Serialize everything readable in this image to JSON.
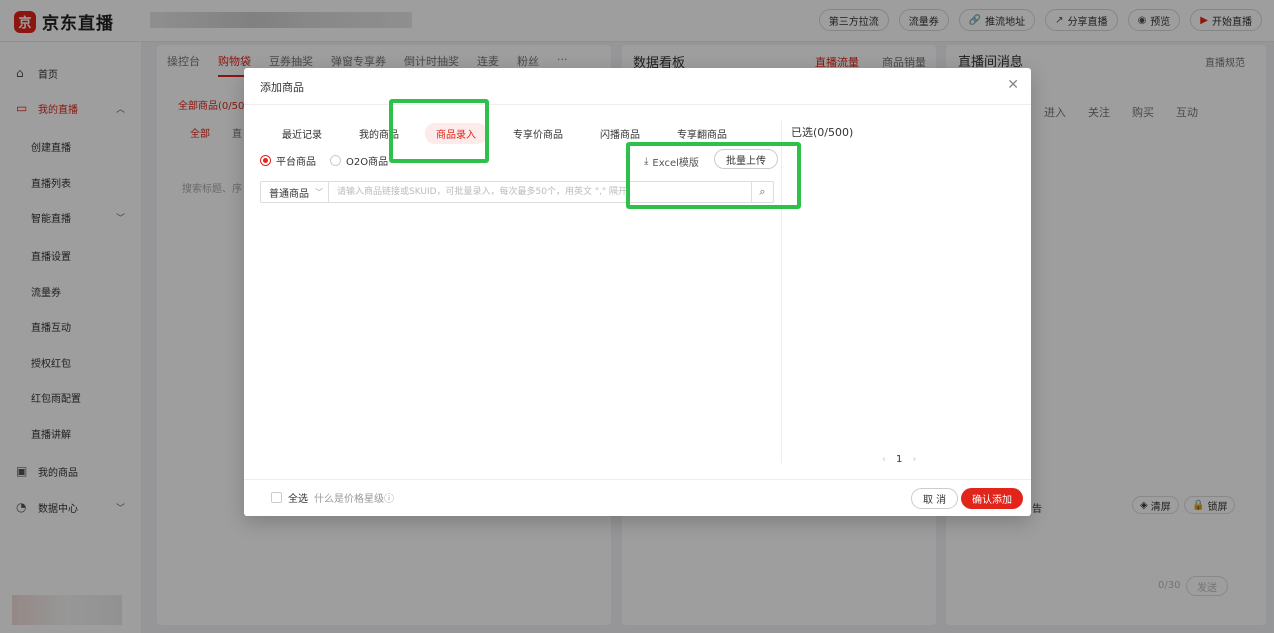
{
  "app": {
    "logo_mark": "京",
    "logo_text": "京东直播"
  },
  "top_actions": [
    {
      "label": "第三方拉流",
      "icon": ""
    },
    {
      "label": "流量券",
      "icon": ""
    },
    {
      "label": "推流地址",
      "icon": "🔗"
    },
    {
      "label": "分享直播",
      "icon": "↗"
    },
    {
      "label": "预览",
      "icon": "◉"
    },
    {
      "label": "开始直播",
      "icon": "▶"
    }
  ],
  "sidebar": {
    "home": "首页",
    "my_live": "我的直播",
    "sub_items": [
      "创建直播",
      "直播列表",
      "智能直播",
      "直播设置",
      "流量券",
      "直播互动",
      "授权红包",
      "红包雨配置",
      "直播讲解"
    ],
    "my_goods": "我的商品",
    "data_center": "数据中心"
  },
  "left_panel": {
    "tabs": [
      "操控台",
      "购物袋",
      "豆券抽奖",
      "弹窗专享券",
      "倒计时抽奖",
      "连麦",
      "粉丝",
      "···"
    ],
    "all_goods": "全部商品(0/500",
    "sub_all": "全部",
    "sub_other": "直",
    "search_placeholder": "搜索标题、序"
  },
  "mid_panel": {
    "title": "数据看板",
    "tab_active": "直播流量",
    "tab_other": "商品销量"
  },
  "right_panel": {
    "title": "直播间消息",
    "rule_link": "直播规范",
    "tabs": [
      "进入",
      "关注",
      "购买",
      "互动"
    ],
    "notice_tail": "告",
    "clear_label": "清屏",
    "lock_label": "锁屏",
    "count": "0/30",
    "send_label": "发送"
  },
  "modal": {
    "title": "添加商品",
    "tabs": [
      "最近记录",
      "我的商品",
      "商品录入",
      "专享价商品",
      "闪播商品",
      "专享翻商品"
    ],
    "active_tab": 2,
    "radio_platform": "平台商品",
    "radio_o2o": "O2O商品",
    "excel_template": "Excel模版",
    "batch_upload": "批量上传",
    "type_select": "普通商品",
    "search_placeholder": "请输入商品链接或SKUID，可批量录入，每次最多50个，用英文 \",\" 隔开",
    "selected": "已选(0/500)",
    "page": "1",
    "select_all": "全选",
    "price_help": "什么是价格星级",
    "cancel": "取 消",
    "confirm": "确认添加"
  },
  "colors": {
    "accent": "#e1251b",
    "highlight": "#2fc04b"
  }
}
